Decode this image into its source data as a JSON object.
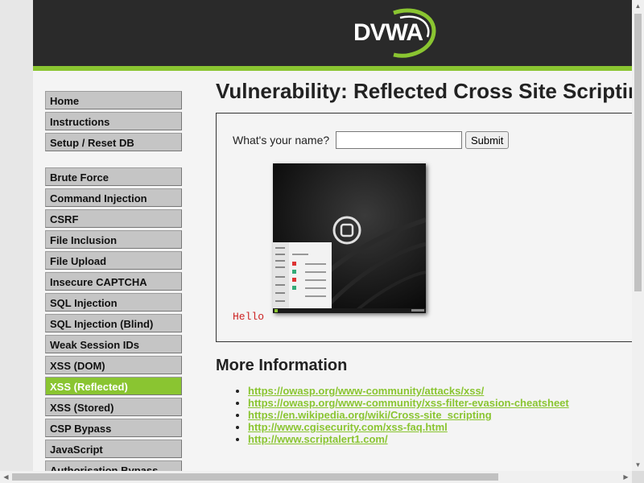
{
  "header": {
    "logo_text": "DVWA"
  },
  "menu": {
    "items": [
      {
        "label": "Home",
        "name": "menu-home"
      },
      {
        "label": "Instructions",
        "name": "menu-instructions"
      },
      {
        "label": "Setup / Reset DB",
        "name": "menu-setup-reset-db"
      }
    ],
    "vuln_items": [
      {
        "label": "Brute Force",
        "name": "menu-brute-force"
      },
      {
        "label": "Command Injection",
        "name": "menu-command-injection"
      },
      {
        "label": "CSRF",
        "name": "menu-csrf"
      },
      {
        "label": "File Inclusion",
        "name": "menu-file-inclusion"
      },
      {
        "label": "File Upload",
        "name": "menu-file-upload"
      },
      {
        "label": "Insecure CAPTCHA",
        "name": "menu-insecure-captcha"
      },
      {
        "label": "SQL Injection",
        "name": "menu-sql-injection"
      },
      {
        "label": "SQL Injection (Blind)",
        "name": "menu-sql-injection-blind"
      },
      {
        "label": "Weak Session IDs",
        "name": "menu-weak-session-ids"
      },
      {
        "label": "XSS (DOM)",
        "name": "menu-xss-dom"
      },
      {
        "label": "XSS (Reflected)",
        "name": "menu-xss-reflected",
        "active": true
      },
      {
        "label": "XSS (Stored)",
        "name": "menu-xss-stored"
      },
      {
        "label": "CSP Bypass",
        "name": "menu-csp-bypass"
      },
      {
        "label": "JavaScript",
        "name": "menu-javascript"
      },
      {
        "label": "Authorisation Bypass",
        "name": "menu-authorisation-bypass"
      }
    ]
  },
  "main": {
    "title": "Vulnerability: Reflected Cross Site Scripting (XSS)",
    "form": {
      "label": "What's your name?",
      "input_value": "",
      "submit_label": "Submit"
    },
    "output_text": "Hello",
    "more_info_title": "More Information",
    "links": [
      "https://owasp.org/www-community/attacks/xss/",
      "https://owasp.org/www-community/xss-filter-evasion-cheatsheet",
      "https://en.wikipedia.org/wiki/Cross-site_scripting",
      "http://www.cgisecurity.com/xss-faq.html",
      "http://www.scriptalert1.com/"
    ]
  },
  "colors": {
    "accent": "#8ac531",
    "header_bg": "#2a2a2a",
    "hello_text": "#cc2222"
  }
}
